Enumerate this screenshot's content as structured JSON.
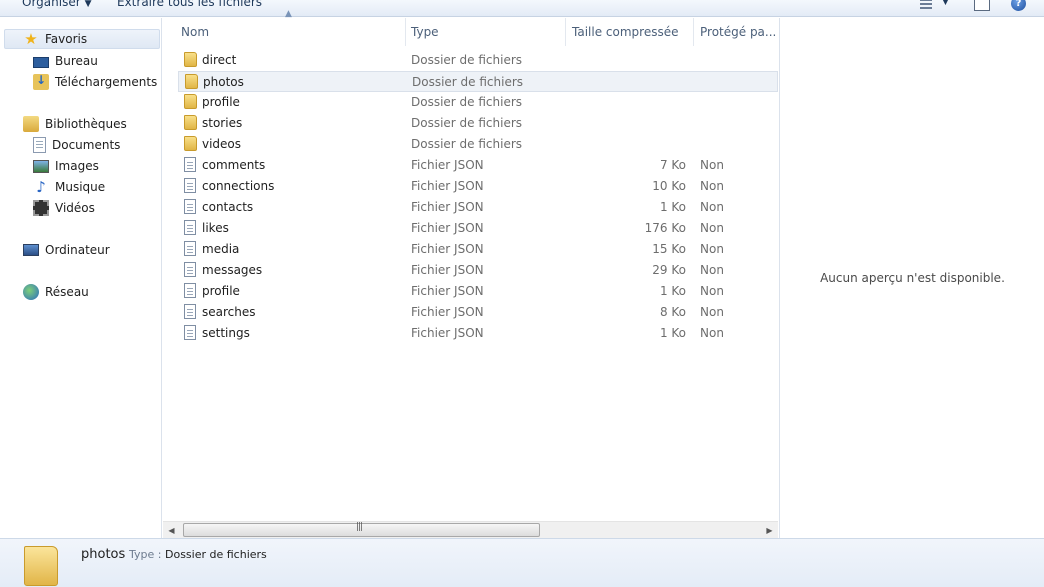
{
  "toolbar": {
    "organise_label": "Organiser",
    "extract_label": "Extraire tous les fichiers"
  },
  "navigation": {
    "favorites_label": "Favoris",
    "desktop_label": "Bureau",
    "downloads_label": "Téléchargements",
    "libraries_label": "Bibliothèques",
    "documents_label": "Documents",
    "images_label": "Images",
    "music_label": "Musique",
    "videos_label": "Vidéos",
    "computer_label": "Ordinateur",
    "network_label": "Réseau"
  },
  "columns": {
    "name": "Nom",
    "type": "Type",
    "compressed_size": "Taille compressée",
    "protected": "Protégé pa..."
  },
  "files": [
    {
      "name": "direct",
      "type": "Dossier de fichiers",
      "size": "",
      "protected": "",
      "icon": "folder-icon"
    },
    {
      "name": "photos",
      "type": "Dossier de fichiers",
      "size": "",
      "protected": "",
      "icon": "folder-icon"
    },
    {
      "name": "profile",
      "type": "Dossier de fichiers",
      "size": "",
      "protected": "",
      "icon": "folder-icon"
    },
    {
      "name": "stories",
      "type": "Dossier de fichiers",
      "size": "",
      "protected": "",
      "icon": "folder-icon"
    },
    {
      "name": "videos",
      "type": "Dossier de fichiers",
      "size": "",
      "protected": "",
      "icon": "folder-icon"
    },
    {
      "name": "comments",
      "type": "Fichier JSON",
      "size": "7 Ko",
      "protected": "Non",
      "icon": "json-file-icon"
    },
    {
      "name": "connections",
      "type": "Fichier JSON",
      "size": "10 Ko",
      "protected": "Non",
      "icon": "json-file-icon"
    },
    {
      "name": "contacts",
      "type": "Fichier JSON",
      "size": "1 Ko",
      "protected": "Non",
      "icon": "json-file-icon"
    },
    {
      "name": "likes",
      "type": "Fichier JSON",
      "size": "176 Ko",
      "protected": "Non",
      "icon": "json-file-icon"
    },
    {
      "name": "media",
      "type": "Fichier JSON",
      "size": "15 Ko",
      "protected": "Non",
      "icon": "json-file-icon"
    },
    {
      "name": "messages",
      "type": "Fichier JSON",
      "size": "29 Ko",
      "protected": "Non",
      "icon": "json-file-icon"
    },
    {
      "name": "profile",
      "type": "Fichier JSON",
      "size": "1 Ko",
      "protected": "Non",
      "icon": "json-file-icon"
    },
    {
      "name": "searches",
      "type": "Fichier JSON",
      "size": "8 Ko",
      "protected": "Non",
      "icon": "json-file-icon"
    },
    {
      "name": "settings",
      "type": "Fichier JSON",
      "size": "1 Ko",
      "protected": "Non",
      "icon": "json-file-icon"
    }
  ],
  "preview": {
    "message": "Aucun aperçu n'est disponible."
  },
  "details": {
    "name": "photos",
    "type_label": "Type :",
    "type_value": "Dossier de fichiers"
  }
}
